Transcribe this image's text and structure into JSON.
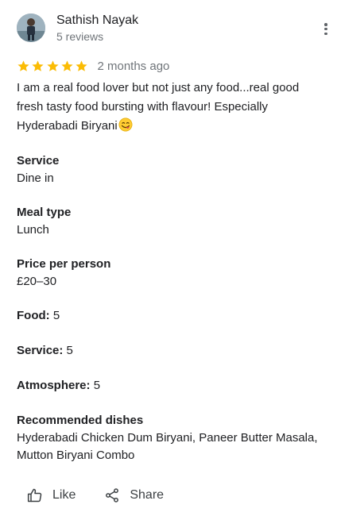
{
  "reviewer": {
    "name": "Sathish Nayak",
    "reviews_count": "5 reviews"
  },
  "rating": {
    "stars": 5,
    "max_stars": 5,
    "time_ago": "2 months ago",
    "star_color": "#fbbc04"
  },
  "review": {
    "text": "I am a real food lover but not just any food...real good fresh tasty food bursting with flavour! Especially Hyderabadi Biryani",
    "emoji_icon": "face-savoring-food-icon"
  },
  "details": {
    "service_label": "Service",
    "service_value": "Dine in",
    "meal_type_label": "Meal type",
    "meal_type_value": "Lunch",
    "price_label": "Price per person",
    "price_value": "£20–30",
    "food_label": "Food:",
    "food_value": "5",
    "service_rating_label": "Service:",
    "service_rating_value": "5",
    "atmosphere_label": "Atmosphere:",
    "atmosphere_value": "5",
    "recommended_label": "Recommended dishes",
    "recommended_value": "Hyderabadi Chicken Dum Biryani, Paneer Butter Masala, Mutton Biryani Combo"
  },
  "actions": {
    "like_label": "Like",
    "share_label": "Share"
  }
}
